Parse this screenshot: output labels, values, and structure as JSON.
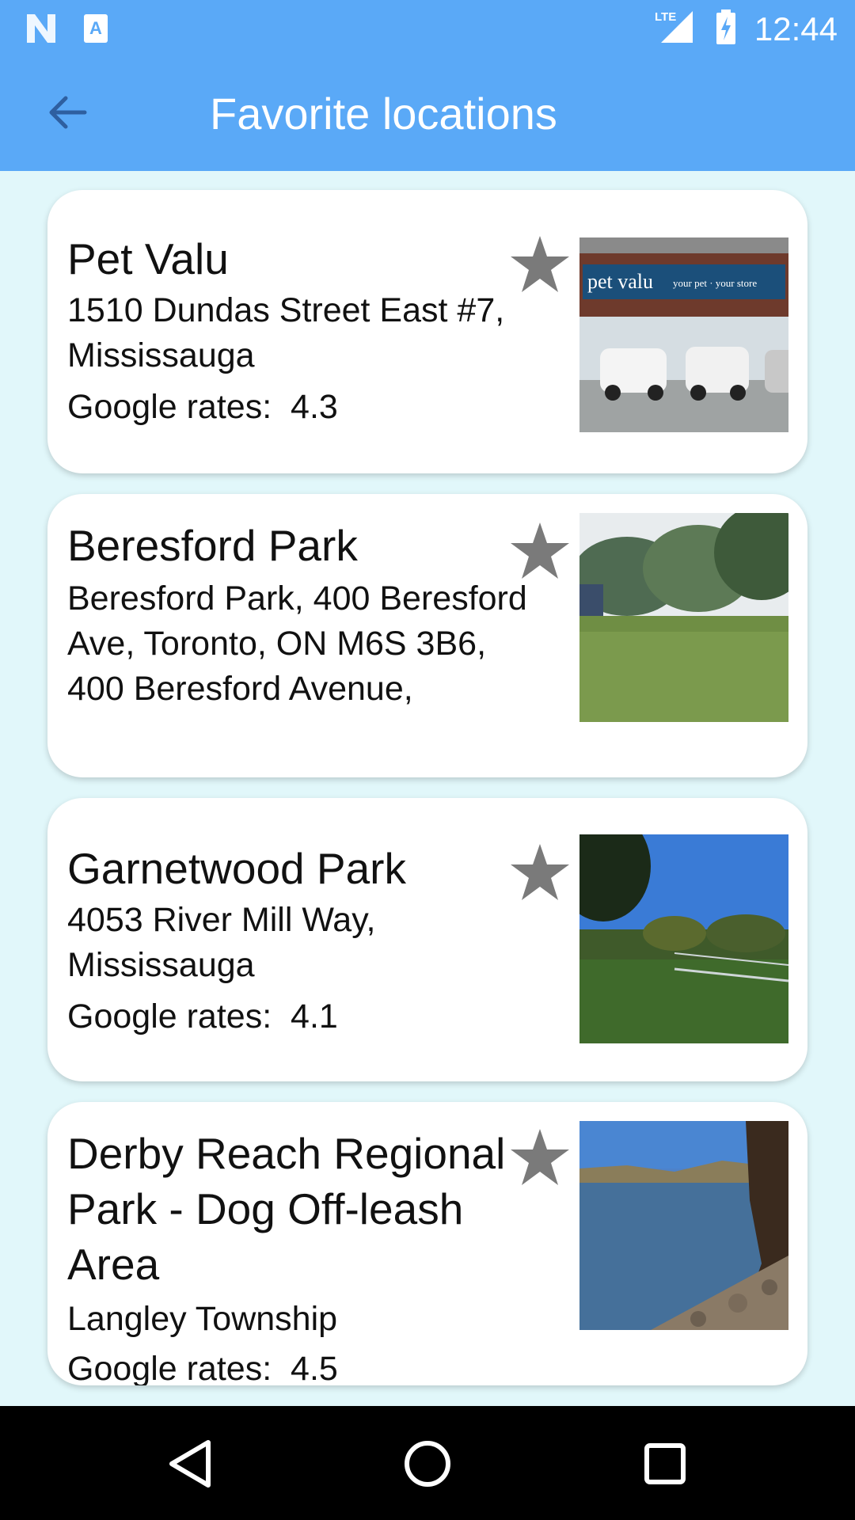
{
  "status_bar": {
    "time": "12:44",
    "network": "LTE",
    "icons": [
      "n-logo-icon",
      "a-notification-icon",
      "signal-icon",
      "battery-charging-icon"
    ]
  },
  "app_bar": {
    "title": "Favorite locations",
    "back_icon": "arrow-back-icon"
  },
  "locations": [
    {
      "title": "Pet Valu",
      "address": "1510 Dundas Street East #7, Mississauga",
      "rating_label": "Google rates:  4.3",
      "image": "storefront-photo"
    },
    {
      "title": "Beresford Park",
      "address": "Beresford Park, 400 Beresford Ave, Toronto, ON M6S 3B6, 400 Beresford Avenue,",
      "image": "park-photo"
    },
    {
      "title": "Garnetwood Park",
      "address": "4053 River Mill Way, Mississauga",
      "rating_label": "Google rates:  4.1",
      "image": "park-fence-photo"
    },
    {
      "title": "Derby Reach Regional Park - Dog Off-leash Area",
      "address": "Langley Township",
      "rating_label": "Google rates:  4.5",
      "image": "river-shore-photo"
    }
  ],
  "photo_text": {
    "storefront_sign": "pet valu",
    "storefront_tagline": "your pet · your store"
  },
  "colors": {
    "primary": "#5aa9f7",
    "background": "#e1f7fa",
    "star": "#7a7a7a"
  },
  "nav_bar": {
    "icons": [
      "back-triangle-icon",
      "home-circle-icon",
      "recents-square-icon"
    ]
  }
}
